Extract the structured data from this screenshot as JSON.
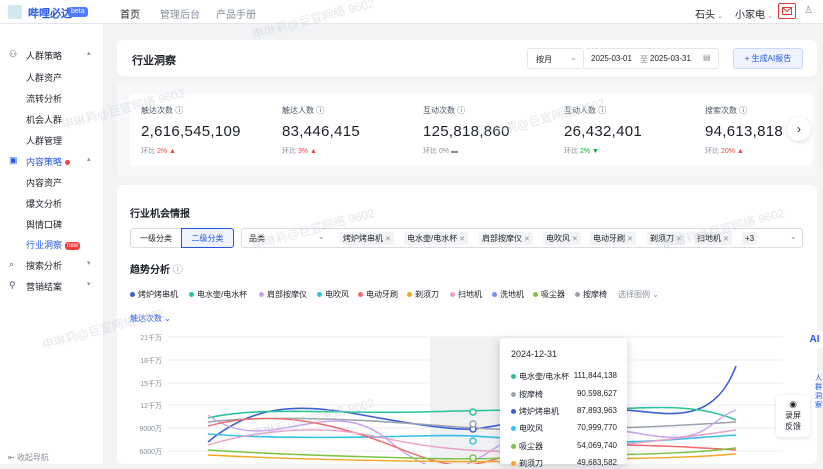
{
  "app": {
    "name": "哔哩必达",
    "badge": "beta"
  },
  "topnav": [
    "首页",
    "管理后台",
    "产品手册"
  ],
  "topright": {
    "user1": "石头",
    "user2": "小家电"
  },
  "sidebar": {
    "items": [
      {
        "label": "人群策略",
        "icon": "people-icon",
        "group": true
      },
      {
        "label": "人群资产"
      },
      {
        "label": "流转分析"
      },
      {
        "label": "机会人群"
      },
      {
        "label": "人群管理"
      },
      {
        "label": "内容策略",
        "icon": "content-icon",
        "group": true
      },
      {
        "label": "内容资产"
      },
      {
        "label": "爆文分析"
      },
      {
        "label": "舆情口碑"
      },
      {
        "label": "行业洞察",
        "badge": "new"
      },
      {
        "label": "搜索分析",
        "icon": "search-icon",
        "group": true
      },
      {
        "label": "营销结案",
        "icon": "settlement-icon",
        "group": true
      }
    ],
    "collapse": "收起导航"
  },
  "page": {
    "title": "行业洞察",
    "granularity": "按月",
    "date_start": "2025-03-01",
    "date_sep": "至",
    "date_end": "2025-03-31",
    "ai_button": "+ 生成AI报告"
  },
  "metrics": [
    {
      "label": "触达次数",
      "value": "2,616,545,109",
      "change_label": "环比",
      "change": "2%",
      "trend": "up"
    },
    {
      "label": "触达人数",
      "value": "83,446,415",
      "change_label": "环比",
      "change": "3%",
      "trend": "up"
    },
    {
      "label": "互动次数",
      "value": "125,818,860",
      "change_label": "环比",
      "change": "0%",
      "trend": "flat"
    },
    {
      "label": "互动人数",
      "value": "26,432,401",
      "change_label": "环比",
      "change": "2%",
      "trend": "down"
    },
    {
      "label": "搜索次数",
      "value": "94,613,818",
      "change_label": "环比",
      "change": "20%",
      "trend": "up"
    }
  ],
  "opportunity": {
    "title": "行业机会情报",
    "tabs": [
      "一级分类",
      "二级分类"
    ],
    "selected_tab": "二级分类",
    "filter_label": "品类",
    "filter_tags": [
      "烤炉烤串机",
      "电水壶/电水杯",
      "肩部按摩仪",
      "电吹风",
      "电动牙刷",
      "剃须刀",
      "扫地机"
    ],
    "more": "+3"
  },
  "trend": {
    "title": "趋势分析",
    "metric_select": "触达次数",
    "legend_select": "选择图例"
  },
  "chart_data": {
    "type": "line",
    "title": "趋势分析",
    "y_ticks": [
      "21千万",
      "18千万",
      "15千万",
      "12千万",
      "9000万",
      "6000万"
    ],
    "ylim": [
      60000000,
      210000000
    ],
    "series": [
      {
        "name": "烤炉烤串机",
        "color": "#3c5fd6"
      },
      {
        "name": "电水壶/电水杯",
        "color": "#29c29a",
        "tooltip_value": "111,844,138"
      },
      {
        "name": "肩部按摩仪",
        "color": "#c8a2f0"
      },
      {
        "name": "电吹风",
        "color": "#35c0e8",
        "tooltip_value": "70,999,770"
      },
      {
        "name": "电动牙刷",
        "color": "#f06a6a"
      },
      {
        "name": "剃须刀",
        "color": "#f5a623",
        "tooltip_value": "49,683,582"
      },
      {
        "name": "扫地机",
        "color": "#e9a0c9"
      },
      {
        "name": "洗地机",
        "color": "#7a8cf0"
      },
      {
        "name": "吸尘器",
        "color": "#7cc242",
        "tooltip_value": "54,069,740"
      },
      {
        "name": "按摩椅",
        "color": "#9aa3ad",
        "tooltip_value": "90,598,627"
      }
    ],
    "tooltip": {
      "date": "2024-12-31",
      "rows": [
        {
          "name": "电水壶/电水杯",
          "value": "111,844,138",
          "color": "#29c29a"
        },
        {
          "name": "按摩椅",
          "value": "90,598,627",
          "color": "#9aa3ad"
        },
        {
          "name": "烤炉烤串机",
          "value": "87,893,963",
          "color": "#3c5fd6"
        },
        {
          "name": "电吹风",
          "value": "70,999,770",
          "color": "#35c0e8"
        },
        {
          "name": "吸尘器",
          "value": "54,069,740",
          "color": "#7cc242"
        },
        {
          "name": "剃须刀",
          "value": "49,683,582",
          "color": "#f5a623"
        }
      ]
    }
  },
  "float": {
    "ai_label": "AI",
    "feedback1": "录屏",
    "feedback2": "反馈",
    "edge": "人群洞察"
  },
  "watermark": "申琳莉@巨宣网络 9602",
  "colors": {
    "primary": "#2456e6",
    "danger": "#f53f3f",
    "success": "#00b42a"
  }
}
